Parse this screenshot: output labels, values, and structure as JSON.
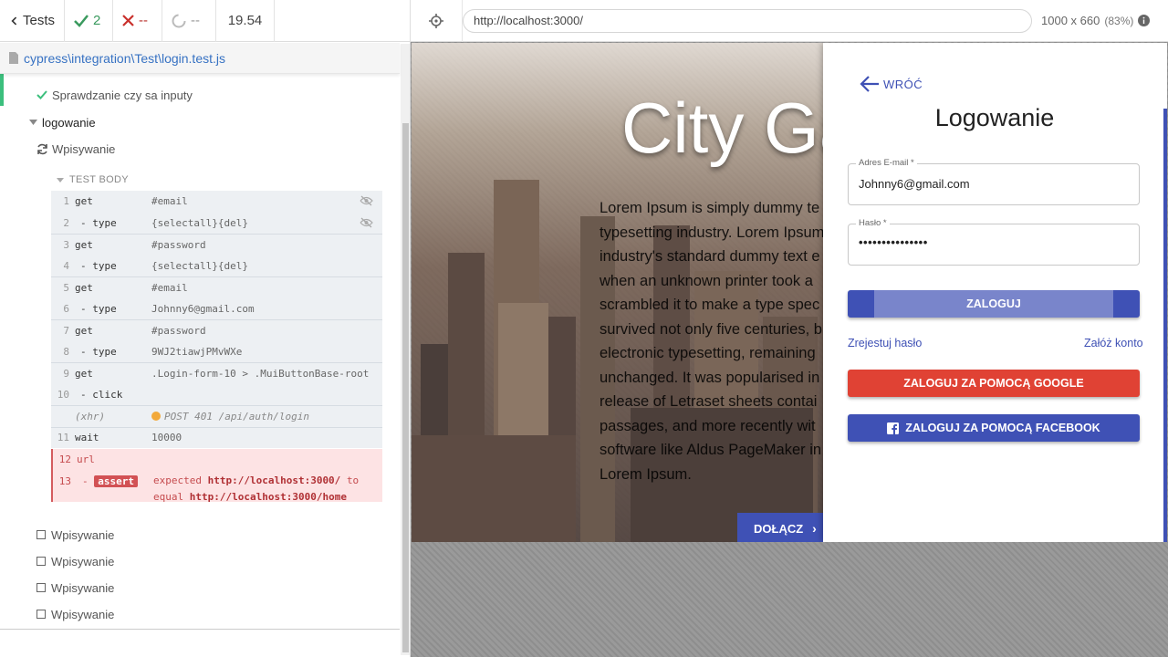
{
  "reporter": {
    "tests_label": "Tests",
    "passed": "2",
    "failed": "--",
    "pending": "--",
    "duration": "19.54",
    "spec_path": "cypress\\integration\\Test\\login.test.js",
    "tests": {
      "passed_test": "Sprawdzanie czy sa inputy",
      "suite": "logowanie",
      "running_test": "Wpisywanie",
      "test_body_label": "TEST BODY",
      "pending_tests": [
        "Wpisywanie",
        "Wpisywanie",
        "Wpisywanie",
        "Wpisywanie"
      ]
    },
    "commands": [
      {
        "num": "1",
        "name": "get",
        "msg": "#email"
      },
      {
        "num": "2",
        "name": "- type",
        "msg": "{selectall}{del}"
      },
      {
        "num": "3",
        "name": "get",
        "msg": "#password"
      },
      {
        "num": "4",
        "name": "- type",
        "msg": "{selectall}{del}"
      },
      {
        "num": "5",
        "name": "get",
        "msg": "#email"
      },
      {
        "num": "6",
        "name": "- type",
        "msg": "Johnny6@gmail.com"
      },
      {
        "num": "7",
        "name": "get",
        "msg": "#password"
      },
      {
        "num": "8",
        "name": "- type",
        "msg": "9WJ2tiawjPMvWXe"
      },
      {
        "num": "9",
        "name": "get",
        "msg": ".Login-form-10 > .MuiButtonBase-root"
      },
      {
        "num": "10",
        "name": "- click",
        "msg": ""
      },
      {
        "num": "",
        "name": "(xhr)",
        "msg": "POST 401 /api/auth/login"
      },
      {
        "num": "11",
        "name": "wait",
        "msg": "10000"
      },
      {
        "num": "12",
        "name": "url",
        "msg": ""
      },
      {
        "num": "13",
        "name": "assert",
        "msg_expected": "expected",
        "msg_url1": "http://localhost:3000/",
        "msg_to": "to",
        "msg_equal": "equal",
        "msg_url2": "http://localhost:3000/home"
      }
    ]
  },
  "aut": {
    "url": "http://localhost:3000/",
    "viewport": "1000 x 660",
    "scale": "(83%)",
    "page": {
      "hero_title": "City Ga",
      "hero_text_lines": [
        "Lorem Ipsum is simply dummy te",
        "typesetting industry. Lorem Ipsum",
        "industry's standard dummy text e",
        "when an unknown printer took a",
        "scrambled it to make a type spec",
        "survived not only five centuries, b",
        "electronic typesetting, remaining",
        "unchanged. It was popularised in",
        "release of Letraset sheets contai",
        "passages, and more recently wit",
        "software like Aldus PageMaker in",
        "Lorem Ipsum."
      ],
      "join_label": "DOŁĄCZ"
    },
    "login": {
      "back_label": "WRÓĆ",
      "title": "Logowanie",
      "email_label": "Adres E-mail *",
      "email_value": "Johnny6@gmail.com",
      "password_label": "Hasło *",
      "password_value": "•••••••••••••••",
      "login_button": "ZALOGUJ",
      "register_link": "Zrejestuj hasło",
      "create_account_link": "Załóż konto",
      "google_button": "ZALOGUJ ZA POMOCĄ GOOGLE",
      "facebook_button": "ZALOGUJ ZA POMOCĄ FACEBOOK"
    }
  },
  "colors": {
    "accent": "#3f51b5",
    "google": "#e04234",
    "passed": "#3cbf7d",
    "failed": "#d25154"
  }
}
